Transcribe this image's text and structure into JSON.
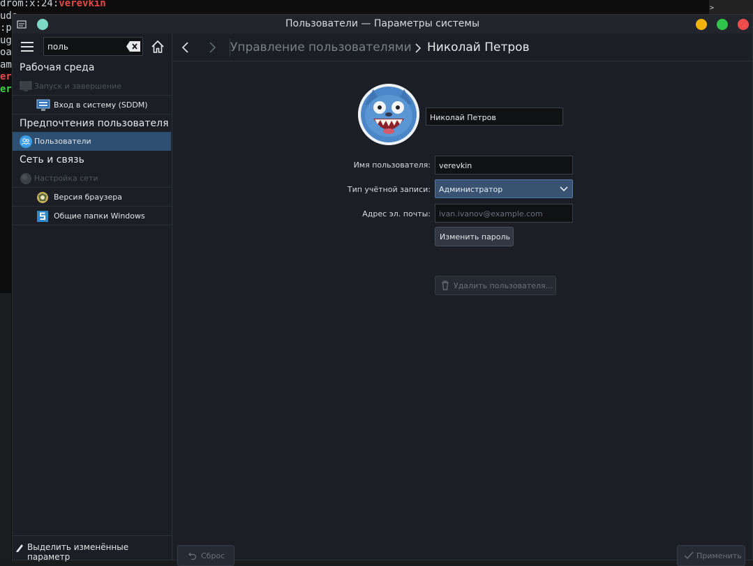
{
  "terminal": {
    "lines": [
      {
        "plain": "drom:x:24:",
        "hl": "verevkin",
        "cls": "red"
      },
      {
        "plain": "udo",
        "hl": "",
        "cls": ""
      },
      {
        "plain": ":p:",
        "hl": "",
        "cls": ""
      },
      {
        "plain": "ug",
        "hl": "",
        "cls": ""
      },
      {
        "plain": "oac",
        "hl": "",
        "cls": ""
      },
      {
        "plain": "amb",
        "hl": "",
        "cls": ""
      },
      {
        "plain": "",
        "hl": "ere",
        "cls": "red"
      },
      {
        "plain": "",
        "hl": "ere",
        "cls": "green"
      }
    ],
    "prompt": ">"
  },
  "window": {
    "title": "Пользователи — Параметры системы",
    "colors": {
      "minimize": "#f0b40c",
      "maximize": "#2fc54a",
      "close": "#f14c4c",
      "pin": "#7ed8c5"
    }
  },
  "sidebar": {
    "search_value": "поль",
    "sections": [
      {
        "title": "Рабочая среда",
        "items": [
          {
            "label": "Запуск и завершение",
            "icon": "monitor-power-icon",
            "disabled": true
          },
          {
            "label": "Вход в систему (SDDM)",
            "icon": "login-screen-icon",
            "disabled": false
          }
        ]
      },
      {
        "title": "Предпочтения пользователя",
        "items": [
          {
            "label": "Пользователи",
            "icon": "users-icon",
            "disabled": false,
            "selected": true
          }
        ]
      },
      {
        "title": "Сеть и связь",
        "items": [
          {
            "label": "Настройка сети",
            "icon": "network-globe-icon",
            "disabled": true
          },
          {
            "label": "Версия браузера",
            "icon": "browser-icon",
            "disabled": false
          },
          {
            "label": "Общие папки Windows",
            "icon": "samba-share-icon",
            "disabled": false
          }
        ]
      }
    ],
    "footer_label": "Выделить изменённые параметр"
  },
  "main": {
    "breadcrumb_parent": "Управление пользователями",
    "breadcrumb_current": "Николай Петров",
    "full_name": "Николай Петров",
    "username_label": "Имя пользователя:",
    "username_value": "verevkin",
    "account_type_label": "Тип учётной записи:",
    "account_type_value": "Администратор",
    "email_label": "Адрес эл. почты:",
    "email_placeholder": "ivan.ivanov@example.com",
    "change_password_label": "Изменить пароль",
    "delete_user_label": "Удалить пользователя...",
    "reset_label": "Сброс",
    "apply_label": "Применить"
  }
}
